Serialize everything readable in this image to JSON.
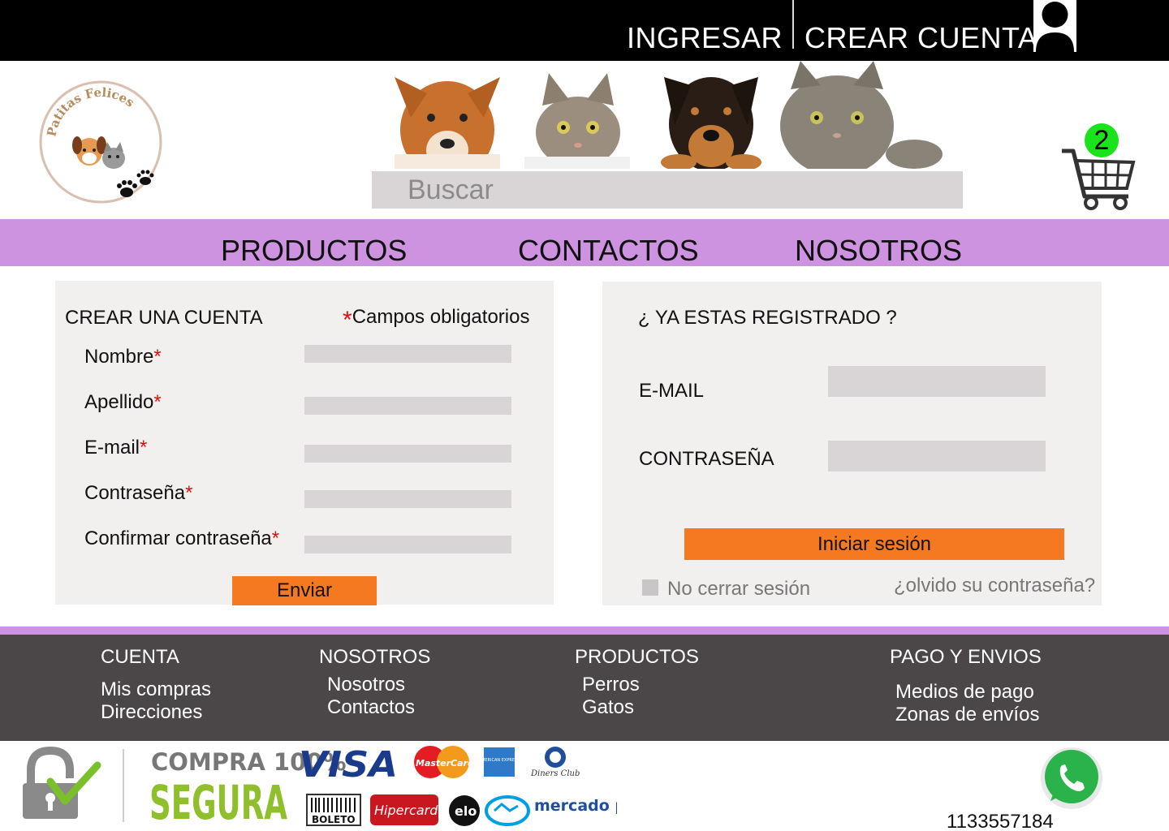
{
  "topbar": {
    "login": "INGRESAR",
    "register": "CREAR CUENTA",
    "user_icon": "user-icon"
  },
  "header": {
    "logo_text": "Patitas Felices",
    "search_placeholder": "Buscar",
    "cart_count": "2",
    "cart_icon": "cart-icon",
    "banner": "dogs-and-cats-banner"
  },
  "nav": {
    "items": [
      "PRODUCTOS",
      "CONTACTOS",
      "NOSOTROS"
    ]
  },
  "register": {
    "title": "CREAR UNA CUENTA",
    "required_note": "Campos obligatorios",
    "asterisk": "*",
    "fields": [
      "Nombre",
      "Apellido",
      "E-mail",
      "Contraseña",
      "Confirmar contraseña"
    ],
    "submit": "Enviar"
  },
  "login": {
    "title": "¿ YA ESTAS REGISTRADO ?",
    "email_label": "E-MAIL",
    "password_label": "CONTRASEÑA",
    "submit": "Iniciar sesión",
    "remember": "No cerrar sesión",
    "forgot": "¿olvido su contraseña?"
  },
  "footer": {
    "columns": [
      {
        "heading": "CUENTA",
        "links": [
          "Mis compras",
          "Direcciones"
        ]
      },
      {
        "heading": "NOSOTROS",
        "links": [
          "Nosotros",
          "Contactos"
        ]
      },
      {
        "heading": "PRODUCTOS",
        "links": [
          "Perros",
          "Gatos"
        ]
      },
      {
        "heading": "PAGO Y ENVIOS",
        "links": [
          "Medios de pago",
          "Zonas de envíos"
        ]
      }
    ]
  },
  "secure": {
    "line1": "COMPRA 100%",
    "line2": "SEGURA",
    "payment_methods": [
      "VISA",
      "MasterCard",
      "AMERICAN EXPRESS",
      "Diners Club",
      "BOLETO",
      "Hipercard",
      "elo",
      "mercado pago"
    ]
  },
  "contact": {
    "phone": "1133557184",
    "whatsapp_icon": "whatsapp-icon"
  },
  "colors": {
    "accent_nav": "#ce93e0",
    "button": "#f57920",
    "footer": "#4b4748",
    "badge": "#1be31b"
  }
}
